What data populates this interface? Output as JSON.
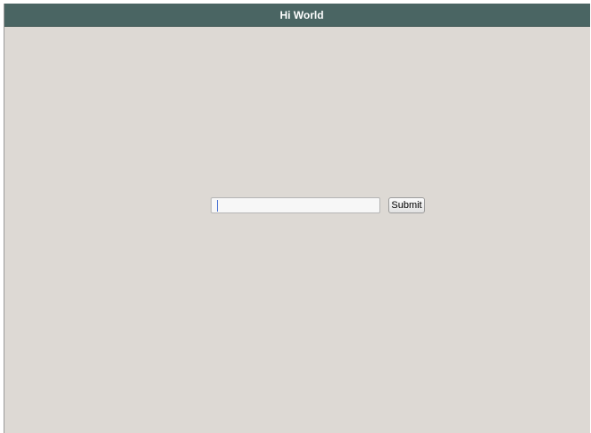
{
  "window": {
    "title": "Hi World"
  },
  "form": {
    "input": {
      "value": "",
      "placeholder": ""
    },
    "submit_label": "Submit"
  },
  "colors": {
    "titlebar": "#4a6563",
    "background": "#ddd9d4",
    "title_text": "#ffffff"
  }
}
